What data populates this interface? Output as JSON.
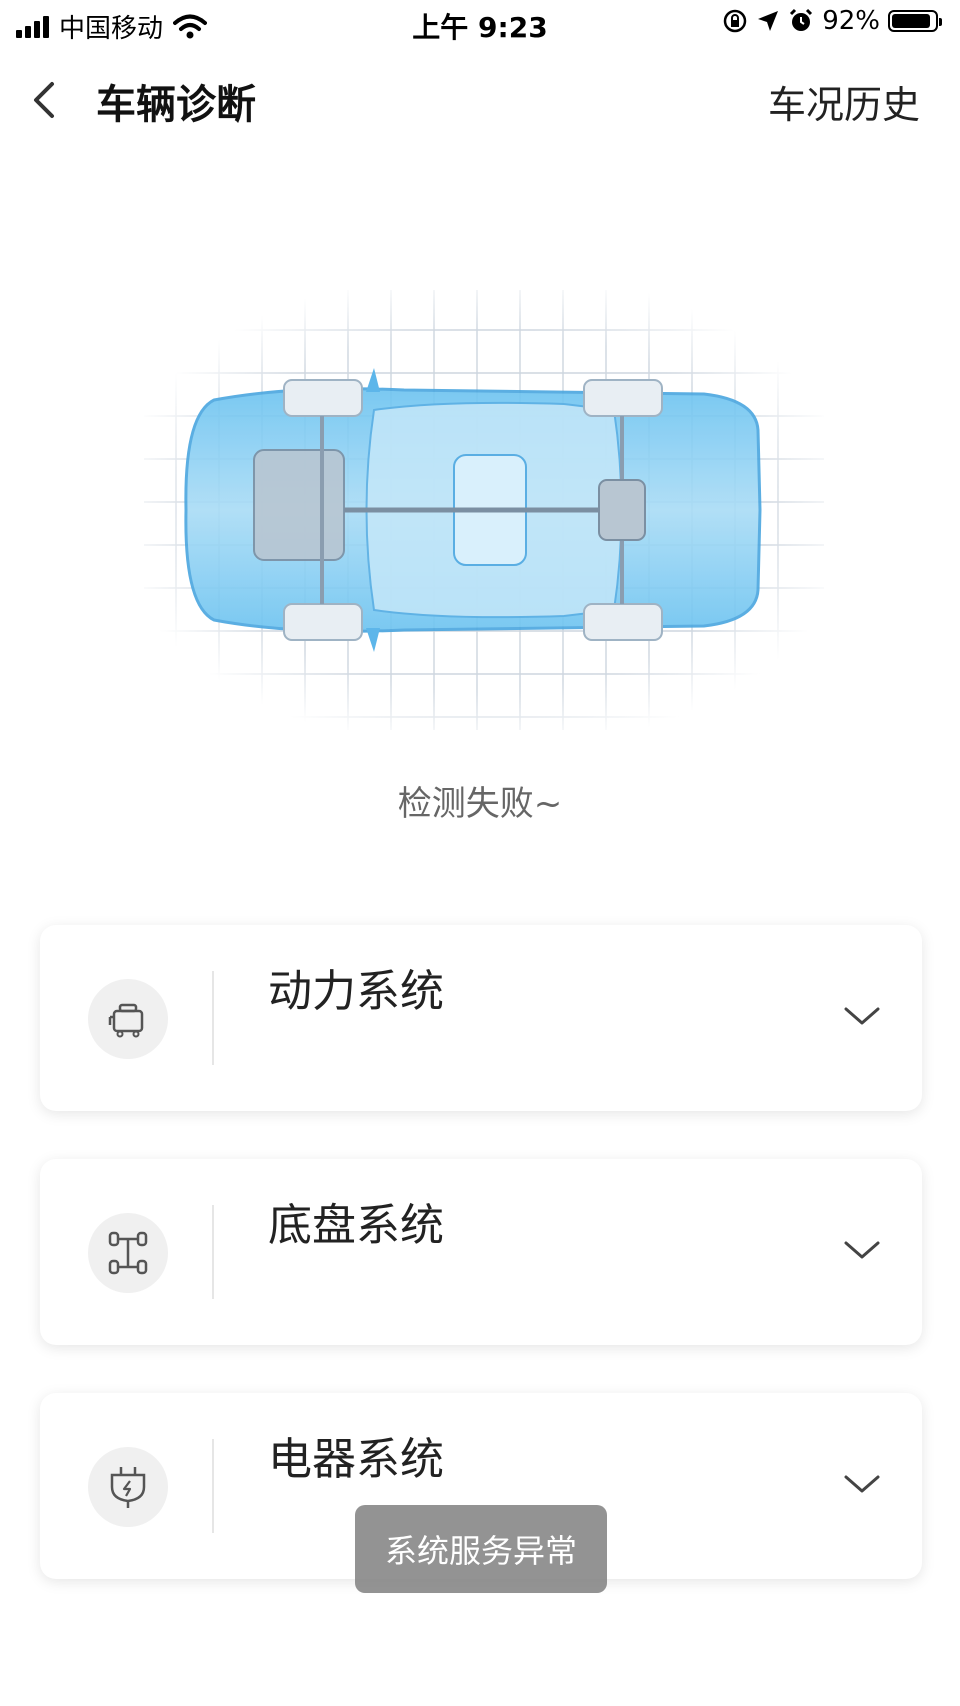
{
  "status_bar": {
    "carrier": "中国移动",
    "time": "上午 9:23",
    "battery": "92%",
    "battery_level": 0.92
  },
  "nav": {
    "title": "车辆诊断",
    "history_label": "车况历史"
  },
  "diagnosis": {
    "result_text": "检测失败~"
  },
  "systems": [
    {
      "label": "动力系统",
      "icon": "engine-icon"
    },
    {
      "label": "底盘系统",
      "icon": "chassis-icon"
    },
    {
      "label": "电器系统",
      "icon": "electric-plug-icon"
    }
  ],
  "toast": {
    "message": "系统服务异常"
  },
  "colors": {
    "car_blue": "#5db6ea",
    "grid": "#c9d2dc",
    "card_icon_bg": "#f0f0f0",
    "toast_bg": "#808080"
  }
}
